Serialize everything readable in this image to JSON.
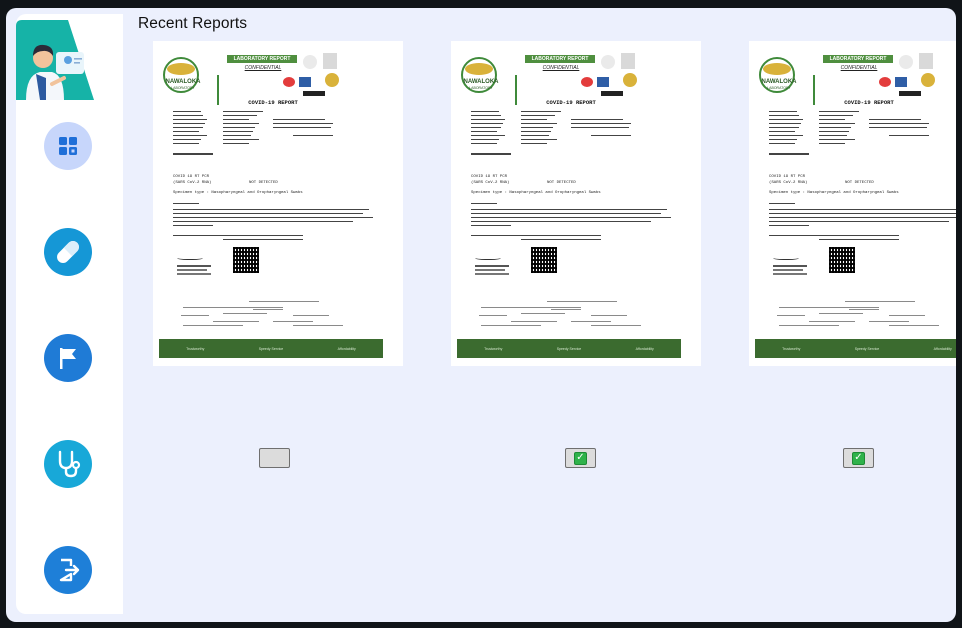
{
  "page": {
    "title": "Recent Reports"
  },
  "sidebar": {
    "items": [
      {
        "name": "dashboard",
        "icon": "dashboard-grid-icon",
        "color": "#c7d6fb"
      },
      {
        "name": "medicine",
        "icon": "pill-capsule-icon",
        "color": "#1597d6"
      },
      {
        "name": "reports",
        "icon": "flag-icon",
        "color": "#1f7bd6"
      },
      {
        "name": "doctors",
        "icon": "stethoscope-icon",
        "color": "#18a8d8"
      },
      {
        "name": "logout",
        "icon": "logout-door-icon",
        "color": "#1e7fd8"
      }
    ]
  },
  "report_doc": {
    "lab_header": "LABORATORY REPORT",
    "confidential": "CONFIDENTIAL",
    "lab_name": "NAWALOKA",
    "lab_sub": "LABORATORY",
    "report_title": "COVID-19 REPORT",
    "test_name": "COVID 19 RT PCR",
    "test_sub": "(SARS CoV-2 RNA)",
    "result": "NOT DETECTED",
    "specimen": "Specimen type : Nasopharyngeal and Oropharyngeal Swabs",
    "footer_items": [
      "Trustworthy",
      "Speedy Service",
      "Affordability"
    ]
  },
  "reports": [
    {
      "id": "report-1",
      "selected": false
    },
    {
      "id": "report-2",
      "selected": true
    },
    {
      "id": "report-3",
      "selected": true
    }
  ],
  "colors": {
    "background": "#ecf0fd",
    "footer_green": "#3b6b2f",
    "header_green": "#4f8f3f"
  }
}
